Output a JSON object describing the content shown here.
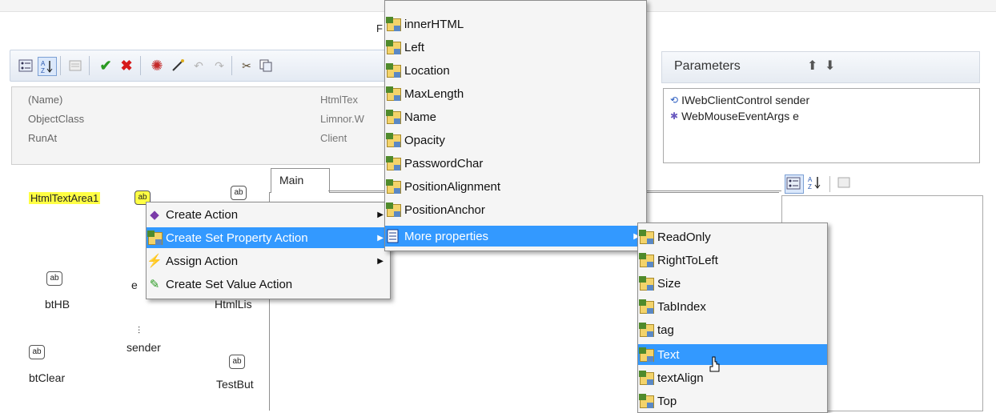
{
  "top_title_fragment": "F",
  "toolbar": {
    "icons": [
      "categorized-icon",
      "alphabetical-sort-icon",
      "property-pages-icon",
      "accept-icon",
      "cancel-icon",
      "sun-icon",
      "magic-wand-icon",
      "undo-icon",
      "redo-icon",
      "cut-icon",
      "copy-icon"
    ]
  },
  "properties": {
    "rows": [
      {
        "name": "(Name)",
        "value": "HtmlTex"
      },
      {
        "name": "ObjectClass",
        "value": "Limnor.W"
      },
      {
        "name": "RunAt",
        "value": "Client"
      }
    ]
  },
  "parameters": {
    "title": "Parameters",
    "items": [
      {
        "label": "IWebClientControl sender"
      },
      {
        "label": "WebMouseEventArgs e"
      }
    ]
  },
  "components": {
    "htmltextarea": "HtmlTextArea1",
    "ab_label": "ab",
    "bthb": "btHB",
    "e_label": "e",
    "htmllis": "HtmlLis",
    "sender": "sender",
    "btclear": "btClear",
    "testbut": "TestBut"
  },
  "tabs": {
    "main": "Main"
  },
  "context_menu": {
    "items": [
      {
        "label": "Create Action",
        "has_submenu": true,
        "selected": false
      },
      {
        "label": "Create Set Property Action",
        "has_submenu": true,
        "selected": true
      },
      {
        "label": "Assign Action",
        "has_submenu": true,
        "selected": false
      },
      {
        "label": "Create Set Value Action",
        "has_submenu": false,
        "selected": false
      }
    ]
  },
  "property_menu": {
    "items": [
      {
        "label": "innerHTML"
      },
      {
        "label": "Left"
      },
      {
        "label": "Location"
      },
      {
        "label": "MaxLength"
      },
      {
        "label": "Name"
      },
      {
        "label": "Opacity"
      },
      {
        "label": "PasswordChar"
      },
      {
        "label": "PositionAlignment"
      },
      {
        "label": "PositionAnchor"
      },
      {
        "label": "More properties"
      }
    ]
  },
  "more_menu": {
    "items": [
      {
        "label": "ReadOnly"
      },
      {
        "label": "RightToLeft"
      },
      {
        "label": "Size"
      },
      {
        "label": "TabIndex"
      },
      {
        "label": "tag"
      },
      {
        "label": "Text"
      },
      {
        "label": "textAlign"
      },
      {
        "label": "Top"
      }
    ]
  },
  "colors": {
    "selection": "#3399ff",
    "highlight": "#ffff44",
    "menu_bg": "#f5f5f5"
  }
}
